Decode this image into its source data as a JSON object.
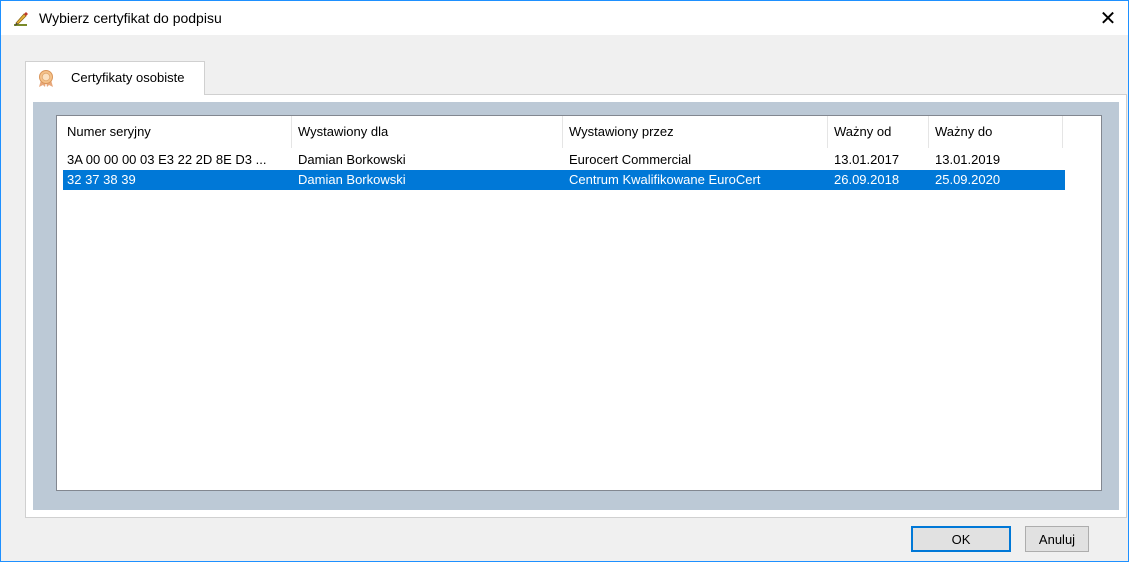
{
  "window": {
    "title": "Wybierz certyfikat do podpisu",
    "close_glyph": "✕",
    "title_icon": "signature-pen-icon"
  },
  "tab": {
    "label": "Certyfikaty osobiste",
    "icon": "certificate-icon"
  },
  "list": {
    "columns": [
      {
        "label": "Numer seryjny"
      },
      {
        "label": "Wystawiony dla"
      },
      {
        "label": "Wystawiony przez"
      },
      {
        "label": "Ważny od"
      },
      {
        "label": "Ważny do"
      }
    ],
    "rows": [
      {
        "serial": "3A 00 00 00 03 E3 22 2D 8E D3 ...",
        "issued_to": "Damian Borkowski",
        "issued_by": "Eurocert Commercial",
        "valid_from": "13.01.2017",
        "valid_to": "13.01.2019",
        "selected": false
      },
      {
        "serial": "32 37 38 39",
        "issued_to": "Damian Borkowski",
        "issued_by": "Centrum Kwalifikowane EuroCert",
        "valid_from": "26.09.2018",
        "valid_to": "25.09.2020",
        "selected": true
      }
    ]
  },
  "buttons": {
    "ok_label": "OK",
    "cancel_label": "Anuluj"
  },
  "colors": {
    "selection": "#0078d7",
    "panel_background": "#bcc9d6",
    "window_border": "#1e90ff"
  }
}
